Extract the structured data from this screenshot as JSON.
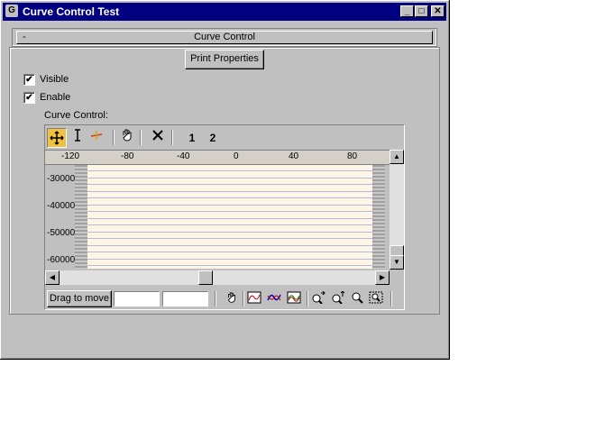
{
  "window": {
    "title": "Curve Control Test",
    "minimize": "_",
    "maximize": "□",
    "close": "✕"
  },
  "rollout": {
    "toggle": "-",
    "title": "Curve Control"
  },
  "panel": {
    "print_button": "Print Properties",
    "visible_label": "Visible",
    "visible_checked": "✔",
    "enable_label": "Enable",
    "enable_checked": "✔",
    "curve_label": "Curve Control:"
  },
  "toolbar": {
    "move_icon": "move-icon",
    "scale_icon": "scale-icon",
    "insert_icon": "insert-point-icon",
    "pan_icon": "hand-icon",
    "delete_icon": "delete-icon",
    "curve1": "1",
    "curve2": "2"
  },
  "ruler": [
    "-120",
    "-80",
    "-40",
    "0",
    "40",
    "80"
  ],
  "y_axis": [
    "-30000",
    "-40000",
    "-50000",
    "-60000"
  ],
  "status": {
    "drag_label": "Drag to move",
    "field1": "",
    "field2": ""
  },
  "colors": {
    "titlebar": "#000080",
    "plot_bg": "#fdf6e6",
    "active_tool": "#f0c040"
  }
}
